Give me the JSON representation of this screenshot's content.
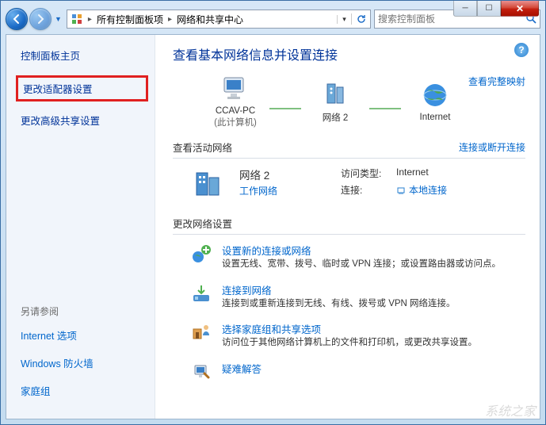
{
  "breadcrumb": {
    "item1": "所有控制面板项",
    "item2": "网络和共享中心"
  },
  "search": {
    "placeholder": "搜索控制面板"
  },
  "sidebar": {
    "home": "控制面板主页",
    "adapter": "更改适配器设置",
    "advanced": "更改高级共享设置",
    "see_also_title": "另请参阅",
    "see_also": {
      "internet": "Internet 选项",
      "firewall": "Windows 防火墙",
      "homegroup": "家庭组"
    }
  },
  "main": {
    "title": "查看基本网络信息并设置连接",
    "full_map": "查看完整映射",
    "node1": {
      "name": "CCAV-PC",
      "sub": "(此计算机)"
    },
    "node2": {
      "name": "网络  2"
    },
    "node3": {
      "name": "Internet"
    },
    "active_section": "查看活动网络",
    "active_link": "连接或断开连接",
    "net": {
      "name": "网络  2",
      "type": "工作网络"
    },
    "props": {
      "access_label": "访问类型:",
      "access_value": "Internet",
      "conn_label": "连接:",
      "conn_value": "本地连接"
    },
    "change_section": "更改网络设置",
    "items": [
      {
        "title": "设置新的连接或网络",
        "desc": "设置无线、宽带、拨号、临时或 VPN 连接；或设置路由器或访问点。"
      },
      {
        "title": "连接到网络",
        "desc": "连接到或重新连接到无线、有线、拨号或 VPN 网络连接。"
      },
      {
        "title": "选择家庭组和共享选项",
        "desc": "访问位于其他网络计算机上的文件和打印机，或更改共享设置。"
      },
      {
        "title": "疑难解答",
        "desc": ""
      }
    ]
  },
  "watermark": "系统之家"
}
